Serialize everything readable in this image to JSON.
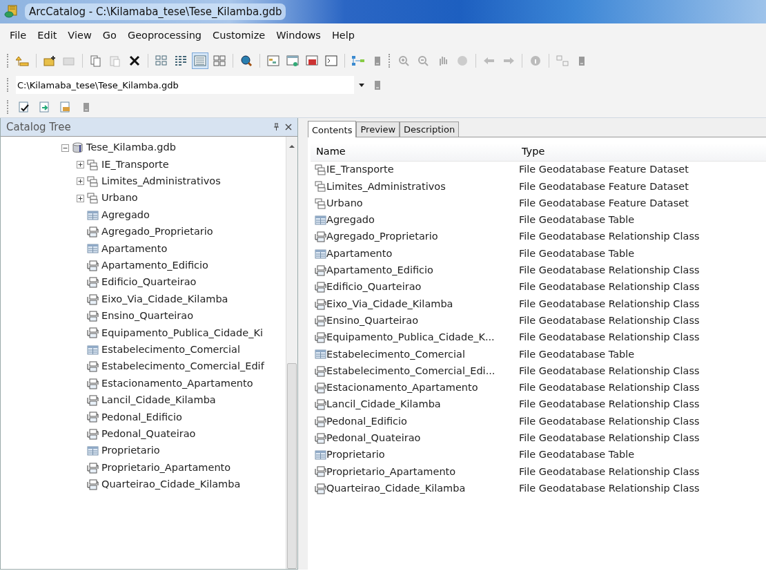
{
  "window": {
    "title": "ArcCatalog - C:\\Kilamaba_tese\\Tese_Kilamba.gdb"
  },
  "menu": [
    "File",
    "Edit",
    "View",
    "Go",
    "Geoprocessing",
    "Customize",
    "Windows",
    "Help"
  ],
  "toolbar": {
    "view_modes": [
      {
        "selected": false
      },
      {
        "selected": false
      },
      {
        "selected": true
      },
      {
        "selected": false
      }
    ]
  },
  "location": {
    "value": "C:\\Kilamaba_tese\\Tese_Kilamba.gdb"
  },
  "catalog_tree": {
    "title": "Catalog Tree",
    "items": [
      {
        "label": "Tese_Kilamba.gdb",
        "kind": "geodatabase",
        "expanded": true,
        "children": [
          {
            "label": "IE_Transporte",
            "kind": "dataset",
            "expanded": false
          },
          {
            "label": "Limites_Administrativos",
            "kind": "dataset",
            "expanded": false
          },
          {
            "label": "Urbano",
            "kind": "dataset",
            "expanded": false
          },
          {
            "label": "Agregado",
            "kind": "table"
          },
          {
            "label": "Agregado_Proprietario",
            "kind": "relationship"
          },
          {
            "label": "Apartamento",
            "kind": "table"
          },
          {
            "label": "Apartamento_Edificio",
            "kind": "relationship"
          },
          {
            "label": "Edificio_Quarteirao",
            "kind": "relationship"
          },
          {
            "label": "Eixo_Via_Cidade_Kilamba",
            "kind": "relationship"
          },
          {
            "label": "Ensino_Quarteirao",
            "kind": "relationship"
          },
          {
            "label": "Equipamento_Publica_Cidade_Ki",
            "kind": "relationship"
          },
          {
            "label": "Estabelecimento_Comercial",
            "kind": "table"
          },
          {
            "label": "Estabelecimento_Comercial_Edif",
            "kind": "relationship"
          },
          {
            "label": "Estacionamento_Apartamento",
            "kind": "relationship"
          },
          {
            "label": "Lancil_Cidade_Kilamba",
            "kind": "relationship"
          },
          {
            "label": "Pedonal_Edificio",
            "kind": "relationship"
          },
          {
            "label": "Pedonal_Quateirao",
            "kind": "relationship"
          },
          {
            "label": "Proprietario",
            "kind": "table"
          },
          {
            "label": "Proprietario_Apartamento",
            "kind": "relationship"
          },
          {
            "label": "Quarteirao_Cidade_Kilamba",
            "kind": "relationship"
          }
        ]
      }
    ]
  },
  "tabs": [
    {
      "label": "Contents",
      "selected": true
    },
    {
      "label": "Preview",
      "selected": false
    },
    {
      "label": "Description",
      "selected": false
    }
  ],
  "table": {
    "columns": [
      "Name",
      "Type"
    ],
    "rows": [
      {
        "name": "IE_Transporte",
        "type": "File Geodatabase Feature Dataset",
        "kind": "dataset"
      },
      {
        "name": "Limites_Administrativos",
        "type": "File Geodatabase Feature Dataset",
        "kind": "dataset"
      },
      {
        "name": "Urbano",
        "type": "File Geodatabase Feature Dataset",
        "kind": "dataset"
      },
      {
        "name": "Agregado",
        "type": "File Geodatabase Table",
        "kind": "table"
      },
      {
        "name": "Agregado_Proprietario",
        "type": "File Geodatabase Relationship Class",
        "kind": "relationship"
      },
      {
        "name": "Apartamento",
        "type": "File Geodatabase Table",
        "kind": "table"
      },
      {
        "name": "Apartamento_Edificio",
        "type": "File Geodatabase Relationship Class",
        "kind": "relationship"
      },
      {
        "name": "Edificio_Quarteirao",
        "type": "File Geodatabase Relationship Class",
        "kind": "relationship"
      },
      {
        "name": "Eixo_Via_Cidade_Kilamba",
        "type": "File Geodatabase Relationship Class",
        "kind": "relationship"
      },
      {
        "name": "Ensino_Quarteirao",
        "type": "File Geodatabase Relationship Class",
        "kind": "relationship"
      },
      {
        "name": "Equipamento_Publica_Cidade_K...",
        "type": "File Geodatabase Relationship Class",
        "kind": "relationship"
      },
      {
        "name": "Estabelecimento_Comercial",
        "type": "File Geodatabase Table",
        "kind": "table"
      },
      {
        "name": "Estabelecimento_Comercial_Edi...",
        "type": "File Geodatabase Relationship Class",
        "kind": "relationship"
      },
      {
        "name": "Estacionamento_Apartamento",
        "type": "File Geodatabase Relationship Class",
        "kind": "relationship"
      },
      {
        "name": "Lancil_Cidade_Kilamba",
        "type": "File Geodatabase Relationship Class",
        "kind": "relationship"
      },
      {
        "name": "Pedonal_Edificio",
        "type": "File Geodatabase Relationship Class",
        "kind": "relationship"
      },
      {
        "name": "Pedonal_Quateirao",
        "type": "File Geodatabase Relationship Class",
        "kind": "relationship"
      },
      {
        "name": "Proprietario",
        "type": "File Geodatabase Table",
        "kind": "table"
      },
      {
        "name": "Proprietario_Apartamento",
        "type": "File Geodatabase Relationship Class",
        "kind": "relationship"
      },
      {
        "name": "Quarteirao_Cidade_Kilamba",
        "type": "File Geodatabase Relationship Class",
        "kind": "relationship"
      }
    ]
  }
}
